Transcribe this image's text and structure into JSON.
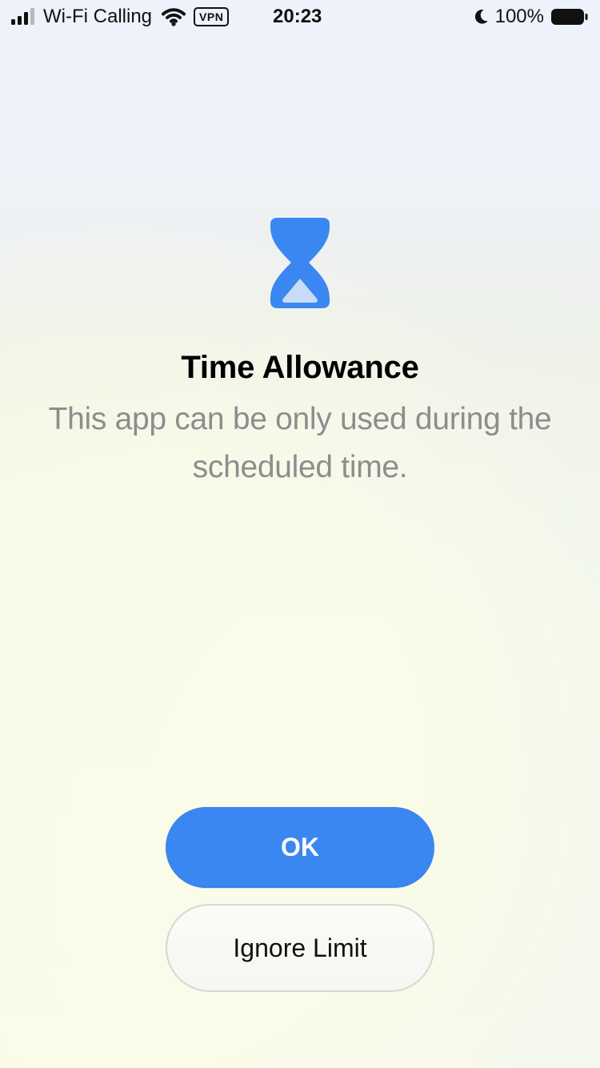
{
  "status_bar": {
    "carrier": "Wi-Fi Calling",
    "vpn": "VPN",
    "time": "20:23",
    "battery_percent": "100%",
    "icons": [
      "signal-icon",
      "wifi-icon",
      "moon-icon",
      "battery-icon"
    ]
  },
  "main": {
    "icon": "hourglass-icon",
    "title": "Time Allowance",
    "subtitle": "This app can be only used during the scheduled time."
  },
  "buttons": {
    "ok": "OK",
    "ignore_limit": "Ignore Limit"
  },
  "colors": {
    "accent": "#3b87f1",
    "hourglass_light": "#c7dcf8",
    "subtitle": "#8d8d8d"
  }
}
